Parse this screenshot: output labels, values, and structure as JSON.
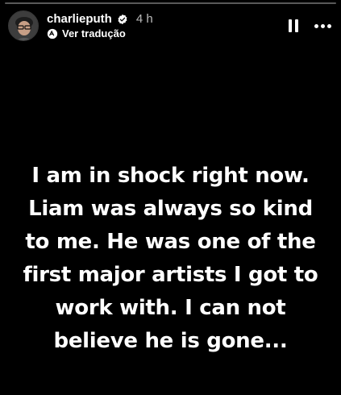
{
  "header": {
    "username": "charlieputh",
    "time": "4 h",
    "translate_label": "Ver tradução",
    "avatar_icon": "profile-photo",
    "verified_icon": "verified-badge",
    "pause_icon": "pause",
    "more_icon": "more-options"
  },
  "story": {
    "lines": [
      "I am in shock right now.",
      "Liam was always so kind",
      "to me. He was one of the",
      "first major artists I got to",
      "work with. I can not",
      "believe he is gone..."
    ]
  },
  "colors": {
    "background": "#000000",
    "text": "#ffffff"
  }
}
